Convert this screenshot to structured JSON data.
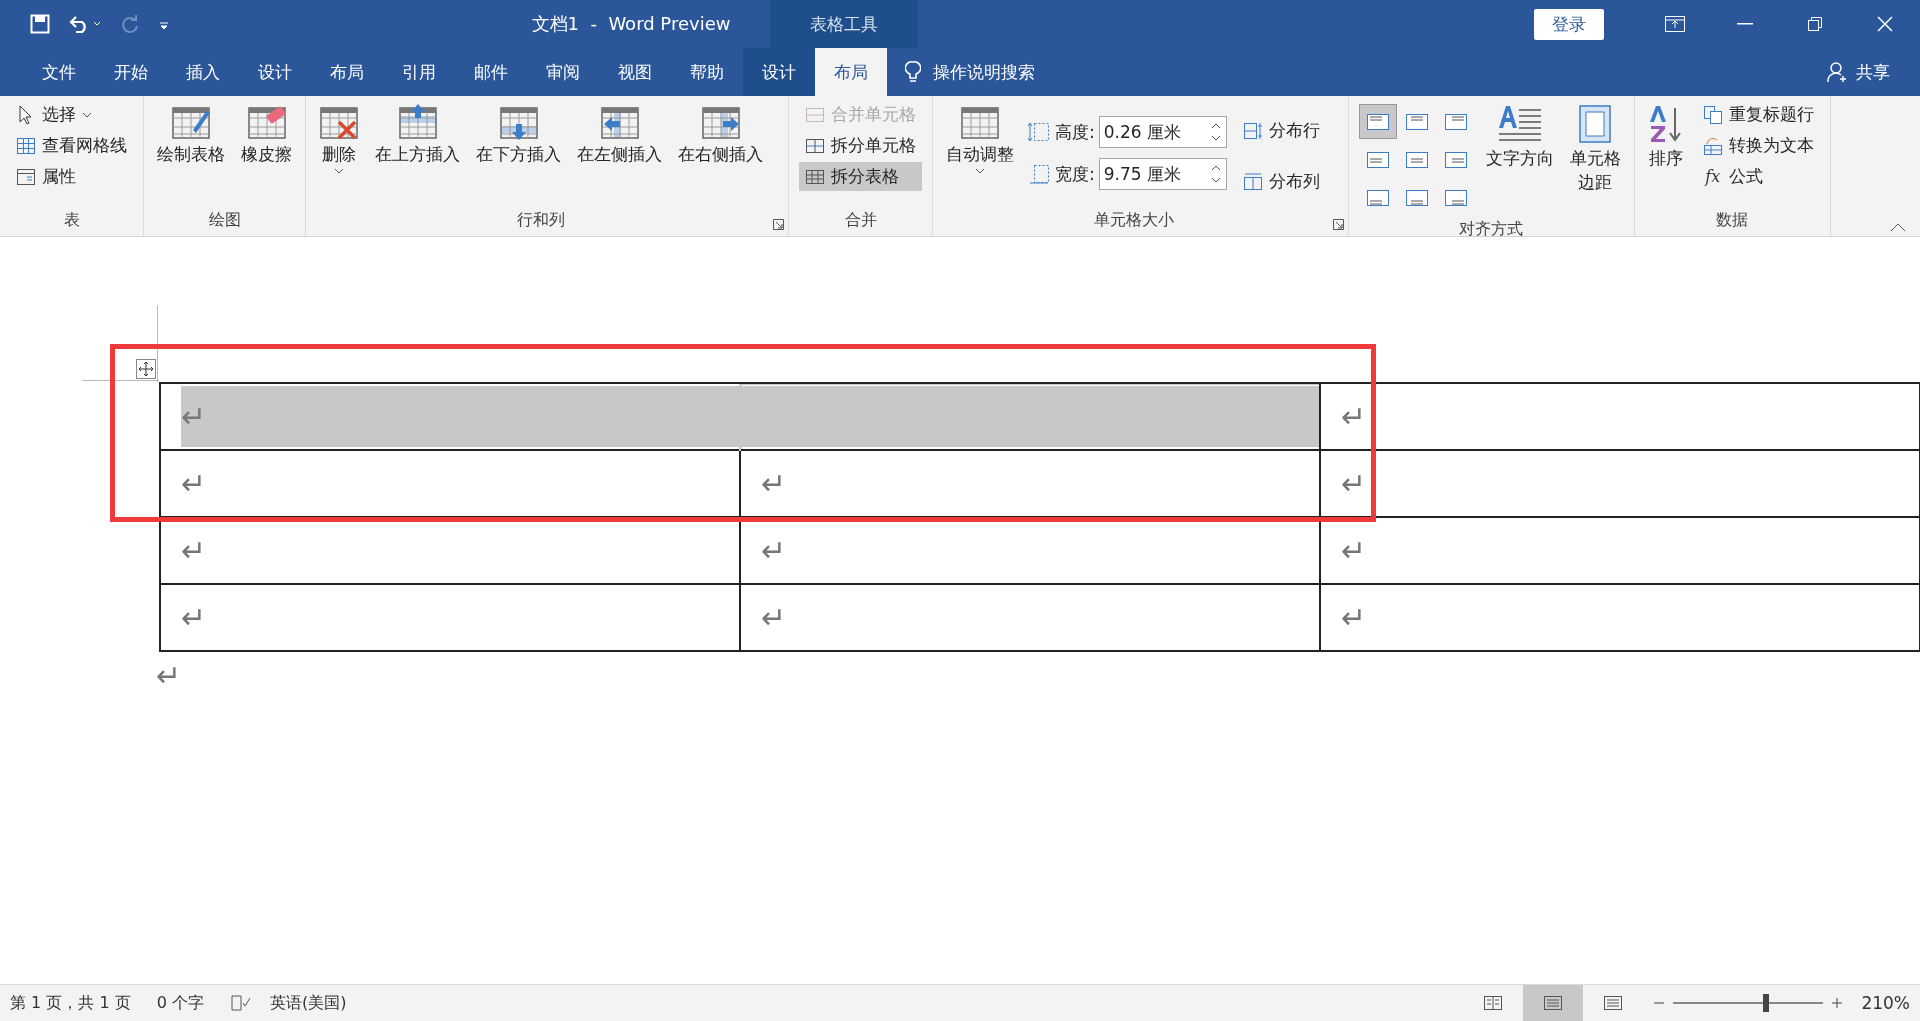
{
  "window": {
    "title": "文档1  -  Word Preview",
    "context_group": "表格工具",
    "login": "登录"
  },
  "menu_tabs": [
    {
      "label": "文件",
      "selected": false
    },
    {
      "label": "开始",
      "selected": false
    },
    {
      "label": "插入",
      "selected": false
    },
    {
      "label": "设计",
      "selected": false
    },
    {
      "label": "布局",
      "selected": false
    },
    {
      "label": "引用",
      "selected": false
    },
    {
      "label": "邮件",
      "selected": false
    },
    {
      "label": "审阅",
      "selected": false
    },
    {
      "label": "视图",
      "selected": false
    },
    {
      "label": "帮助",
      "selected": false
    }
  ],
  "context_tabs": [
    {
      "label": "设计",
      "selected": false
    },
    {
      "label": "布局",
      "selected": true
    }
  ],
  "tell_me": "操作说明搜索",
  "share": "共享",
  "ribbon": [
    {
      "label": "表",
      "launcher": false,
      "columns": [
        [
          {
            "kind": "small",
            "label": "选择",
            "dropdown": true
          },
          {
            "kind": "small",
            "label": "查看网格线"
          },
          {
            "kind": "small",
            "label": "属性"
          }
        ]
      ]
    },
    {
      "label": "绘图",
      "launcher": false,
      "columns": [
        [
          {
            "kind": "large",
            "label": "绘制表格"
          }
        ],
        [
          {
            "kind": "large",
            "label": "橡皮擦"
          }
        ]
      ]
    },
    {
      "label": "行和列",
      "launcher": true,
      "columns": [
        [
          {
            "kind": "large",
            "label": "删除",
            "dropdown": true
          }
        ],
        [
          {
            "kind": "large",
            "label": "在上方插入"
          }
        ],
        [
          {
            "kind": "large",
            "label": "在下方插入"
          }
        ],
        [
          {
            "kind": "large",
            "label": "在左侧插入"
          }
        ],
        [
          {
            "kind": "large",
            "label": "在右侧插入"
          }
        ]
      ]
    },
    {
      "label": "合并",
      "launcher": false,
      "columns": [
        [
          {
            "kind": "small",
            "label": "合并单元格",
            "disabled": true,
            "selected": false
          },
          {
            "kind": "small",
            "label": "拆分单元格",
            "disabled": false,
            "selected": false
          },
          {
            "kind": "small",
            "label": "拆分表格",
            "disabled": false,
            "selected": true
          }
        ]
      ]
    },
    {
      "label": "单元格大小",
      "launcher": true,
      "columns": [
        [
          {
            "kind": "large",
            "label": "自动调整",
            "dropdown": true
          }
        ],
        [
          {
            "kind": "spin",
            "label": "高度:",
            "value": "0.26 厘米"
          },
          {
            "kind": "spin",
            "label": "宽度:",
            "value": "9.75 厘米"
          }
        ],
        [
          {
            "kind": "small",
            "label": "分布行"
          },
          {
            "kind": "small",
            "label": "分布列"
          }
        ]
      ]
    },
    {
      "label": "对齐方式",
      "launcher": false,
      "columns": [
        [
          {
            "kind": "grid",
            "cells": [
              {
                "selected": true
              },
              {
                "selected": false
              },
              {
                "selected": false
              },
              {
                "selected": false
              },
              {
                "selected": false
              },
              {
                "selected": false
              },
              {
                "selected": false
              },
              {
                "selected": false
              },
              {
                "selected": false
              }
            ]
          }
        ],
        [
          {
            "kind": "large",
            "label": "文字方向"
          }
        ],
        [
          {
            "kind": "large",
            "lines": [
              "单元格",
              "边距"
            ]
          }
        ]
      ]
    },
    {
      "label": "数据",
      "launcher": false,
      "columns": [
        [
          {
            "kind": "large",
            "label": "排序"
          }
        ],
        [
          {
            "kind": "small",
            "label": "重复标题行"
          },
          {
            "kind": "small",
            "label": "转换为文本"
          },
          {
            "kind": "small",
            "label": "公式",
            "icon_text": "fx"
          }
        ]
      ]
    }
  ],
  "document": {
    "highlight_frame": true,
    "table": {
      "rows": [
        {
          "cells": [
            {
              "text": "↵",
              "selected": true
            },
            {
              "merged": true,
              "selected": true
            },
            {
              "text": "↵",
              "selected": false
            }
          ]
        },
        {
          "cells": [
            {
              "text": "↵",
              "selected": false
            },
            {
              "text": "↵",
              "selected": false
            },
            {
              "text": "↵",
              "selected": false
            }
          ]
        },
        {
          "cells": [
            {
              "text": "↵",
              "selected": false
            },
            {
              "text": "↵",
              "selected": false
            },
            {
              "text": "↵",
              "selected": false
            }
          ]
        },
        {
          "cells": [
            {
              "text": "↵",
              "selected": false
            },
            {
              "text": "↵",
              "selected": false
            },
            {
              "text": "↵",
              "selected": false
            }
          ]
        }
      ]
    },
    "end_mark": "↵"
  },
  "status_bar": {
    "page": "第 1 页，共 1 页",
    "words": "0 个字",
    "language": "英语(美国)",
    "views": [
      {
        "selected": false
      },
      {
        "selected": true
      },
      {
        "selected": false
      }
    ],
    "zoom": {
      "level": 0.62,
      "reading": "210%"
    }
  }
}
